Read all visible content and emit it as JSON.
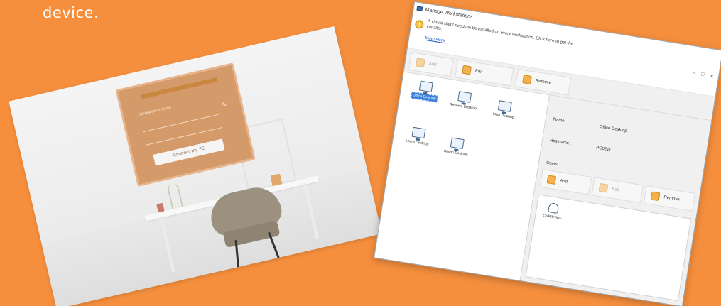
{
  "caption": "device.",
  "photo": {
    "screen_hint": "Workstation name",
    "connect_label": "Connect my PC"
  },
  "dialog": {
    "title": "Manage Workstations",
    "info_message": "A virtual client needs to be installed on every workstation. Click here to get the installer.",
    "info_link": "More Here",
    "window_controls": [
      "–",
      "□",
      "✕"
    ],
    "toolbar": [
      {
        "label": "Add",
        "icon": "plus-monitor-icon",
        "disabled": true
      },
      {
        "label": "Edit",
        "icon": "pencil-icon",
        "disabled": false
      },
      {
        "label": "Remove",
        "icon": "remove-monitor-icon",
        "disabled": false
      }
    ],
    "workstations": [
      {
        "label": "Office Desktop",
        "selected": true
      },
      {
        "label": "Reserve Desktop",
        "selected": false
      },
      {
        "label": "Mike Desktop",
        "selected": false
      },
      {
        "label": "Laura Desktop",
        "selected": false
      },
      {
        "label": "Simon Desktop",
        "selected": false
      }
    ],
    "details": {
      "name_label": "Name:",
      "name_value": "Office Desktop",
      "hostname_label": "Hostname:",
      "hostname_value": "PC0211",
      "users_label": "Users:"
    },
    "users_toolbar": [
      {
        "label": "Add",
        "icon": "add-user-icon",
        "disabled": false
      },
      {
        "label": "Edit",
        "icon": "edit-user-icon",
        "disabled": true
      },
      {
        "label": "Remove",
        "icon": "remove-user-icon",
        "disabled": false
      }
    ],
    "users": [
      {
        "label": "CHRISTINE"
      }
    ]
  },
  "colors": {
    "background": "#f58f3e",
    "selection": "#3b7fd8",
    "accent_icon": "#f3b24b"
  }
}
